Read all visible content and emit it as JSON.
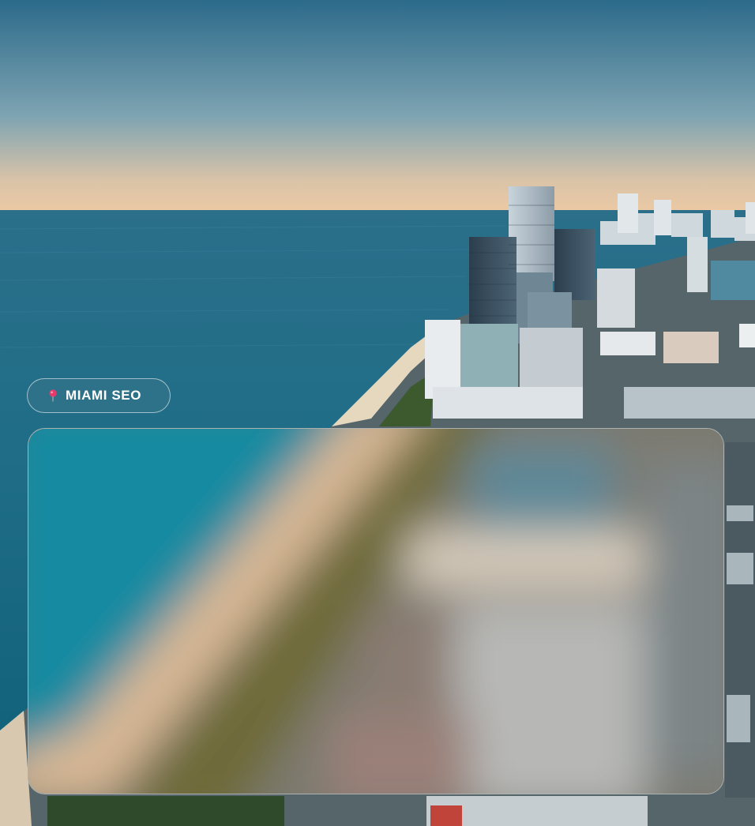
{
  "location_badge": {
    "label": "MIAMI SEO",
    "icon": "map-pin-icon"
  },
  "media": {
    "icon": "blurred-preview-image"
  },
  "colors": {
    "sky_top": "#2f6f8e",
    "sky_bottom": "#e8c9a8",
    "ocean": "#1d6f86",
    "pin": "#e83a6a",
    "pill_border": "#ffffff"
  }
}
